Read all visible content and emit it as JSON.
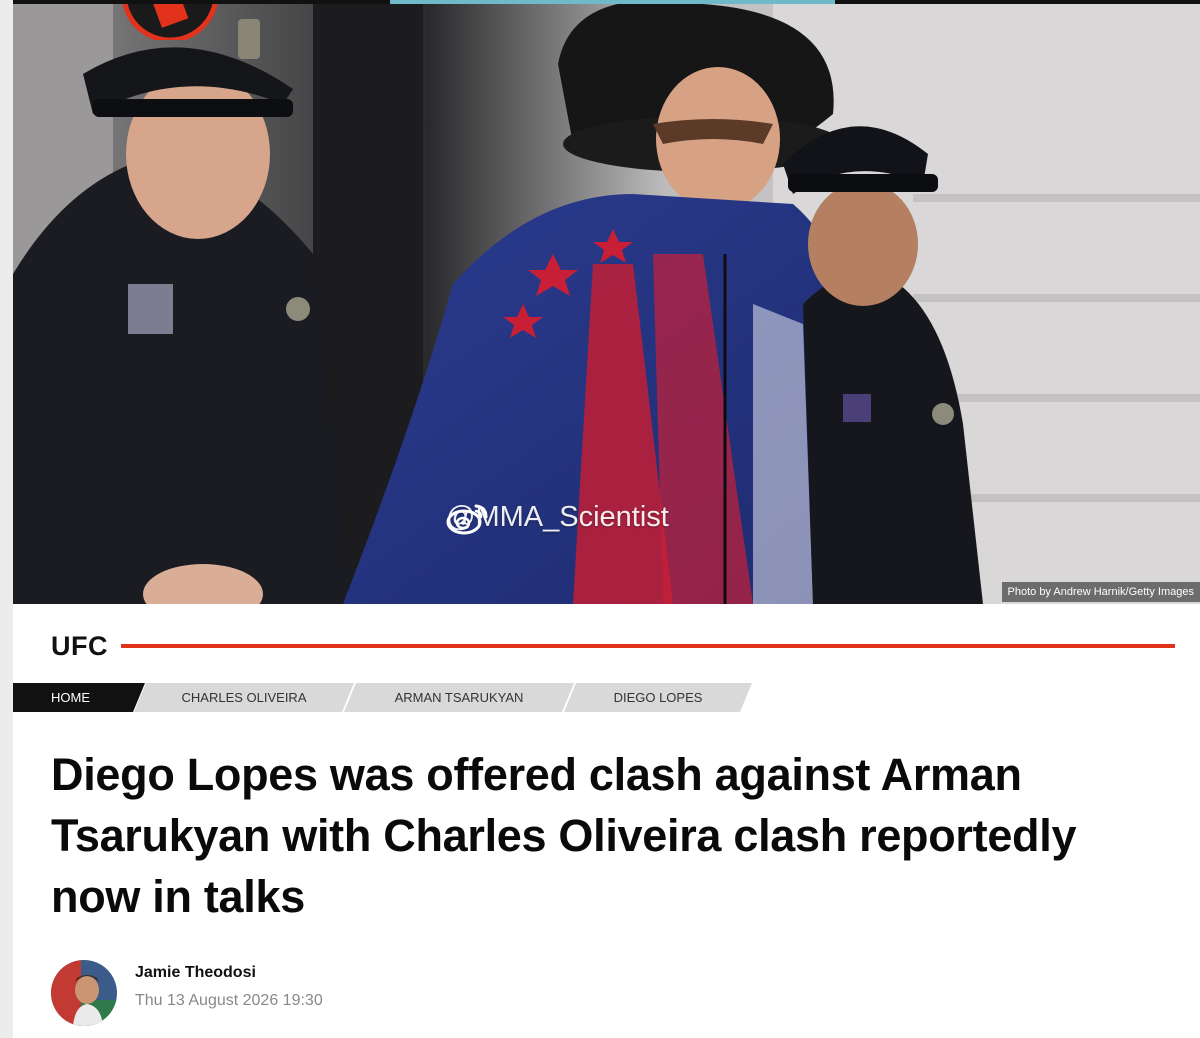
{
  "hero": {
    "photo_credit": "Photo by Andrew Harnik/Getty Images",
    "watermark": "@MMA_Scientist",
    "watermark_icon": "weibo-icon"
  },
  "site": {
    "logo_icon": "site-logo-icon"
  },
  "section": {
    "label": "UFC",
    "accent_color": "#e2321c"
  },
  "breadcrumbs": [
    {
      "label": "HOME"
    },
    {
      "label": "CHARLES OLIVEIRA"
    },
    {
      "label": "ARMAN TSARUKYAN"
    },
    {
      "label": "DIEGO LOPES"
    }
  ],
  "article": {
    "headline": "Diego Lopes was offered clash against Arman Tsarukyan with Charles Oliveira clash reportedly now in talks",
    "author": "Jamie Theodosi",
    "date": "Thu 13 August 2026 19:30"
  }
}
